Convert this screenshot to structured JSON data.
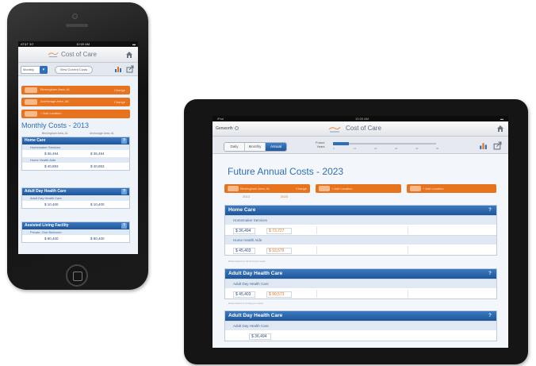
{
  "phone": {
    "status": {
      "carrier": "AT&T 3G",
      "time": "10:00 AM",
      "battery": ""
    },
    "app_title": "Cost of Care",
    "toolbar": {
      "period_select": "Monthly",
      "year_button": "View Current Costs"
    },
    "locations": [
      {
        "name": "Birmingham Area, AL",
        "action": "Change"
      },
      {
        "name": "Anchorage Area, AK",
        "action": "Change"
      },
      {
        "name": "+ Add Location",
        "action": ""
      }
    ],
    "heading": "Monthly Costs - 2013",
    "column_labels": [
      "Birmingham Area, AL",
      "Anchorage Area, AL"
    ],
    "cards": [
      {
        "title": "Home Care",
        "help": "?",
        "rows": [
          {
            "service": "Homemaker Services",
            "values": [
              "$ 36,494",
              "$ 36,494"
            ]
          },
          {
            "service": "Home Health Aide",
            "values": [
              "$ 40,893",
              "$ 40,893"
            ]
          }
        ]
      },
      {
        "title": "Adult Day Health Care",
        "help": "?",
        "rows": [
          {
            "service": "Adult Day Health Care",
            "values": [
              "$ 10,400",
              "$ 10,400"
            ]
          }
        ]
      },
      {
        "title": "Assisted Living Facility",
        "help": "?",
        "rows": [
          {
            "service": "Private, One Bedroom",
            "values": [
              "$ 80,400",
              "$ 80,400"
            ]
          }
        ]
      }
    ]
  },
  "tablet": {
    "status": {
      "left": "iPad",
      "time": "10:00 AM",
      "battery": ""
    },
    "brand": "Genworth",
    "app_title": "Cost of Care",
    "period_tabs": [
      {
        "label": "Daily",
        "active": false
      },
      {
        "label": "Monthly",
        "active": false
      },
      {
        "label": "Annual",
        "active": true
      }
    ],
    "future_label": "Future",
    "years_label": "Years",
    "slider_fraction": 0.15,
    "slider_ticks": [
      "0",
      "10",
      "20",
      "30",
      "40",
      "50"
    ],
    "heading": "Future Annual Costs - 2023",
    "locations": [
      {
        "name": "Birmingham Area, AL",
        "action": "Change"
      },
      {
        "name": "+ Add Location",
        "action": ""
      },
      {
        "name": "+ Add Location",
        "action": ""
      }
    ],
    "year_labels": [
      "2013",
      "2023"
    ],
    "cards": [
      {
        "title": "Home Care",
        "help": "?",
        "rows": [
          {
            "service": "Homemaker Services",
            "values": [
              "$ 36,494",
              "$ 73,727"
            ]
          },
          {
            "service": "Home Health Aide",
            "values": [
              "$ 45,403",
              "$ 93,579"
            ]
          }
        ],
        "note": "Rates based on 44 hours per week"
      },
      {
        "title": "Adult Day Health Care",
        "help": "?",
        "rows": [
          {
            "service": "Adult Day Health Care",
            "values": [
              "$ 45,403",
              "$ 90,573"
            ]
          }
        ],
        "note": "Rates based on 5 days per week"
      },
      {
        "title": "Adult Day Health Care",
        "help": "?",
        "rows": [
          {
            "service": "Adult Day Health Care",
            "values": [
              "$ 36,494",
              ""
            ]
          }
        ]
      }
    ]
  },
  "colors": {
    "accent_blue": "#2f6fb5",
    "accent_orange": "#e8731e",
    "header_blue": "#1f5597"
  }
}
